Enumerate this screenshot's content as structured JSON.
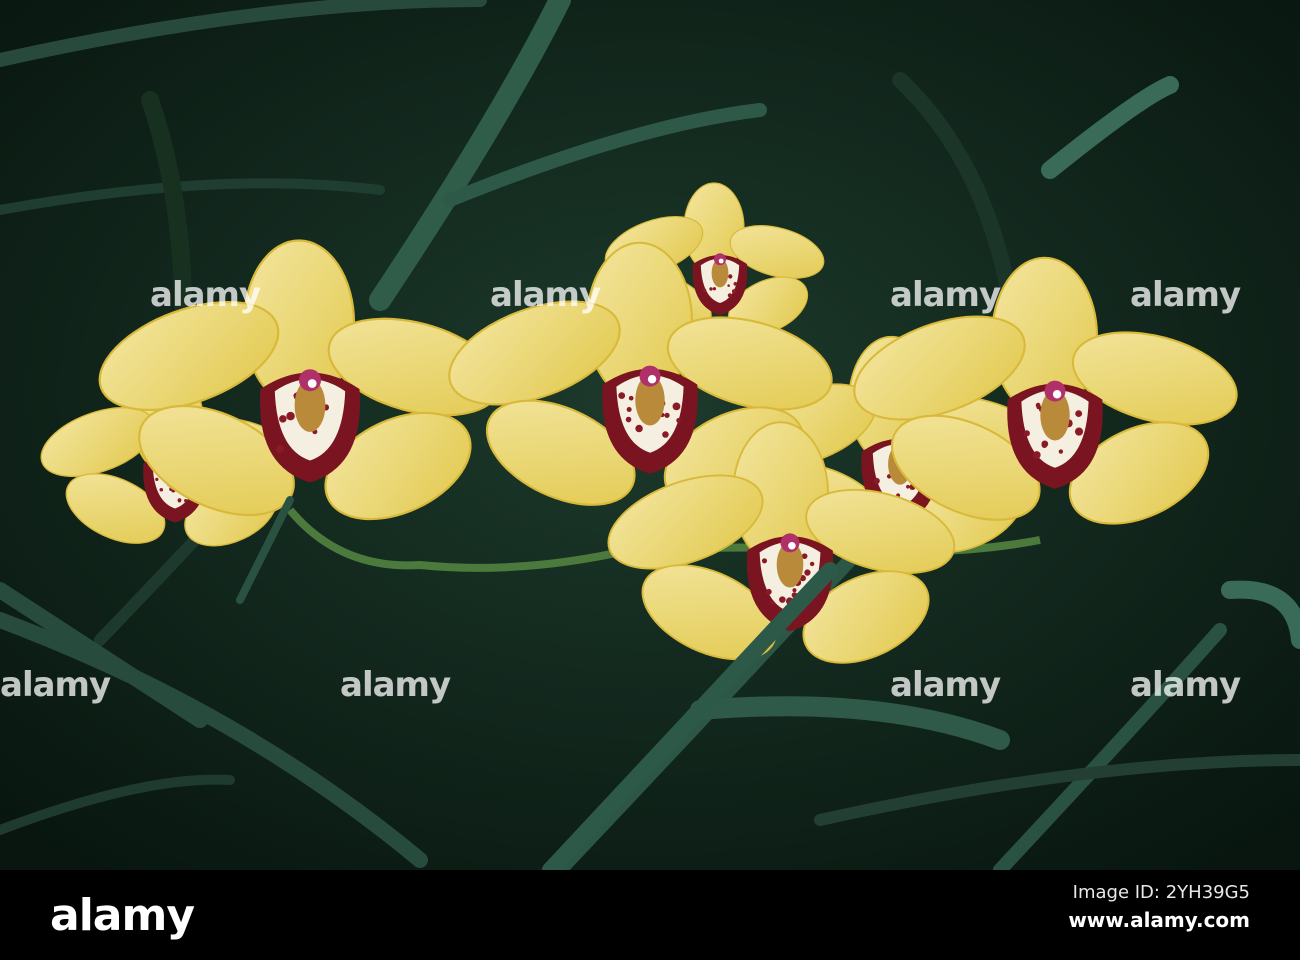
{
  "photo": {
    "subject": "yellow cymbidium orchids",
    "colors": {
      "background": "#0f2419",
      "leaf": "#2f5d4a",
      "petal": "#ecdc7c",
      "lip": "#7a1420",
      "column": "#b0306a"
    }
  },
  "watermark": {
    "text": "alamy"
  },
  "footer": {
    "logo": "alamy",
    "image_id": "Image ID: 2YH39G5",
    "site": "www.alamy.com"
  }
}
